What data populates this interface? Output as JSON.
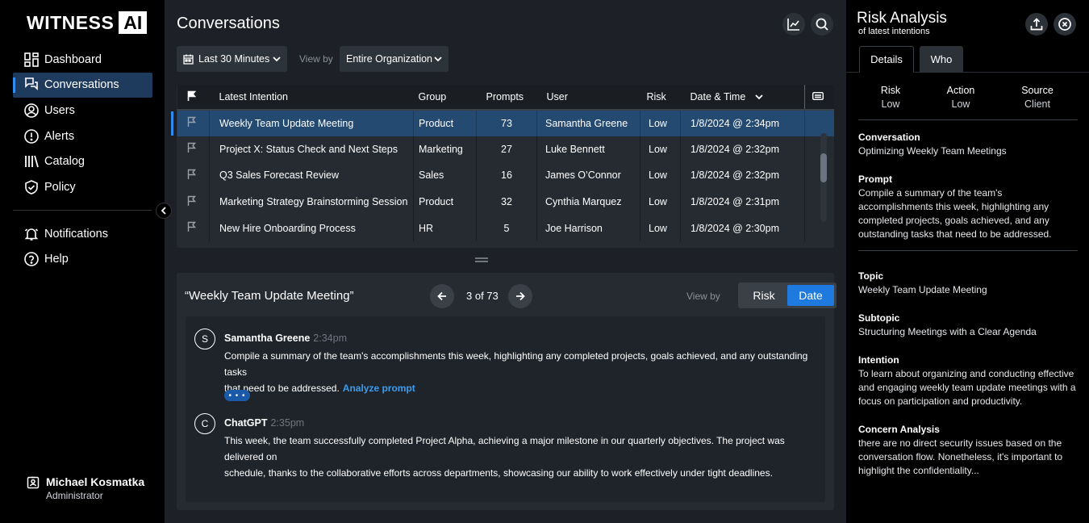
{
  "brand": {
    "word": "WITNESS",
    "box": "AI"
  },
  "sidebar": {
    "items": [
      {
        "label": "Dashboard",
        "icon": "dashboard-icon"
      },
      {
        "label": "Conversations",
        "icon": "conversations-icon",
        "active": true
      },
      {
        "label": "Users",
        "icon": "user-icon"
      },
      {
        "label": "Alerts",
        "icon": "alert-icon"
      },
      {
        "label": "Catalog",
        "icon": "catalog-icon"
      },
      {
        "label": "Policy",
        "icon": "shield-icon"
      }
    ],
    "items2": [
      {
        "label": "Notifications",
        "icon": "bell-icon"
      },
      {
        "label": "Help",
        "icon": "help-icon"
      }
    ],
    "user": {
      "name": "Michael Kosmatka",
      "role": "Administrator"
    }
  },
  "main": {
    "title": "Conversations",
    "filters": {
      "time": "Last 30 Minutes",
      "view_by_label": "View by",
      "view_by": "Entire Organization"
    }
  },
  "table": {
    "columns": [
      "Latest Intention",
      "Group",
      "Prompts",
      "User",
      "Risk",
      "Date & Time"
    ],
    "rows": [
      {
        "intention": "Weekly Team Update Meeting",
        "group": "Product",
        "prompts": "73",
        "user": "Samantha Greene",
        "risk": "Low",
        "date": "1/8/2024 @ 2:34pm"
      },
      {
        "intention": "Project X: Status Check and Next Steps",
        "group": "Marketing",
        "prompts": "27",
        "user": "Luke Bennett",
        "risk": "Low",
        "date": "1/8/2024 @ 2:32pm"
      },
      {
        "intention": "Q3 Sales Forecast Review",
        "group": "Sales",
        "prompts": "16",
        "user": "James O’Connor",
        "risk": "Low",
        "date": "1/8/2024 @ 2:32pm"
      },
      {
        "intention": "Marketing Strategy Brainstorming Session",
        "group": "Product",
        "prompts": "32",
        "user": "Cynthia Marquez",
        "risk": "Low",
        "date": "1/8/2024 @ 2:31pm"
      },
      {
        "intention": "New Hire Onboarding Process",
        "group": "HR",
        "prompts": "5",
        "user": "Joe Harrison",
        "risk": "Low",
        "date": "1/8/2024 @ 2:30pm"
      }
    ]
  },
  "detail": {
    "title": "“Weekly Team Update Meeting”",
    "pager": "3 of 73",
    "view_by_label": "View by",
    "seg_risk": "Risk",
    "seg_date": "Date",
    "msg1": {
      "avatar": "S",
      "name": "Samantha Greene",
      "time": "2:34pm",
      "line1": "Compile a summary of the team's accomplishments this week, highlighting any completed projects, goals achieved, and any outstanding tasks",
      "line2": "that need to be addressed.",
      "link": "Analyze prompt",
      "more": "• • •"
    },
    "msg2": {
      "avatar": "C",
      "name": "ChatGPT",
      "time": "2:35pm",
      "line1": "This week, the team successfully completed Project Alpha, achieving a major milestone in our quarterly objectives. The project was delivered on",
      "line2": "schedule, thanks to the collaborative efforts across departments, showcasing our ability to work effectively under tight deadlines."
    }
  },
  "right": {
    "title": "Risk Analysis",
    "subtitle": "of latest intentions",
    "tabs": [
      "Details",
      "Who"
    ],
    "stats": [
      {
        "k": "Risk",
        "v": "Low"
      },
      {
        "k": "Action",
        "v": "Low"
      },
      {
        "k": "Source",
        "v": "Client"
      }
    ],
    "conversation": {
      "k": "Conversation",
      "v": "Optimizing Weekly Team Meetings"
    },
    "prompt": {
      "k": "Prompt",
      "v": "Compile a summary of the team's accomplishments this week, highlighting any completed projects, goals achieved, and any outstanding tasks that need to be addressed."
    },
    "topic": {
      "k": "Topic",
      "v": "Weekly Team Update Meeting"
    },
    "subtopic": {
      "k": "Subtopic",
      "v": "Structuring Meetings with a Clear Agenda"
    },
    "intention": {
      "k": "Intention",
      "v": "To learn about organizing and conducting effective and engaging weekly team update meetings with a focus on participation and productivity."
    },
    "concern": {
      "k": "Concern Analysis",
      "v": "there are no direct security issues based on the conversation flow. Nonetheless, it's important to highlight the confidentiality..."
    }
  }
}
